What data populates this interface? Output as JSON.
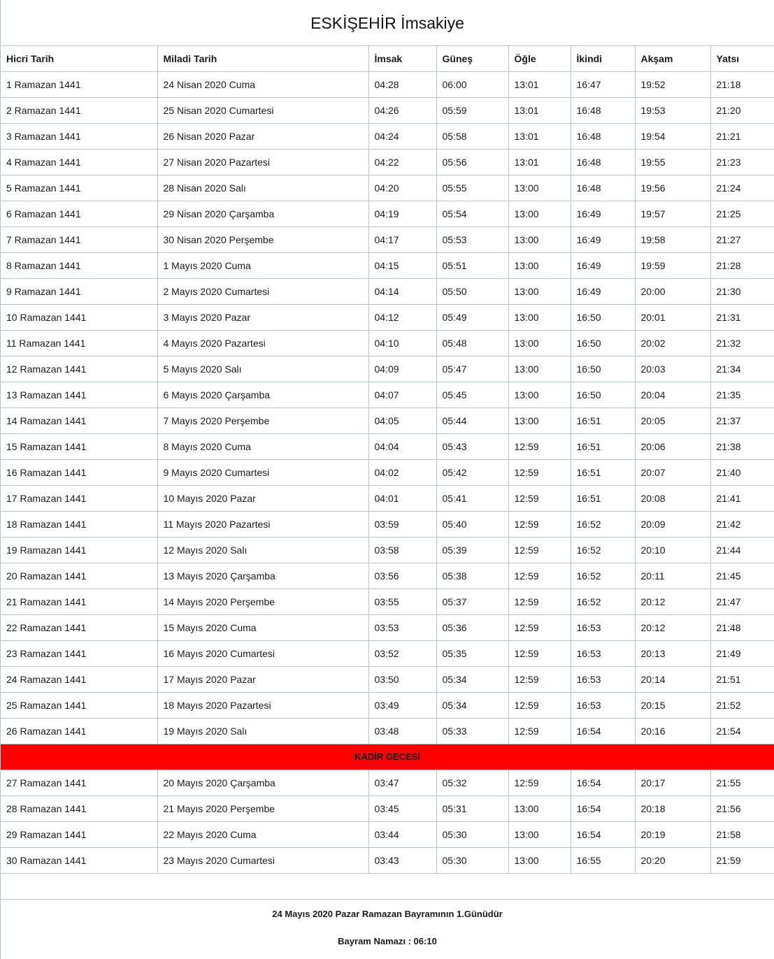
{
  "title": "ESKİŞEHİR İmsakiye",
  "headers": [
    "Hicri Tarih",
    "Miladi Tarih",
    "İmsak",
    "Güneş",
    "Öğle",
    "İkindi",
    "Akşam",
    "Yatsı"
  ],
  "rows_a": [
    [
      "1 Ramazan 1441",
      "24 Nisan 2020 Cuma",
      "04:28",
      "06:00",
      "13:01",
      "16:47",
      "19:52",
      "21:18"
    ],
    [
      "2 Ramazan 1441",
      "25 Nisan 2020 Cumartesi",
      "04:26",
      "05:59",
      "13:01",
      "16:48",
      "19:53",
      "21:20"
    ],
    [
      "3 Ramazan 1441",
      "26 Nisan 2020 Pazar",
      "04:24",
      "05:58",
      "13:01",
      "16:48",
      "19:54",
      "21:21"
    ],
    [
      "4 Ramazan 1441",
      "27 Nisan 2020 Pazartesi",
      "04:22",
      "05:56",
      "13:01",
      "16:48",
      "19:55",
      "21:23"
    ],
    [
      "5 Ramazan 1441",
      "28 Nisan 2020 Salı",
      "04:20",
      "05:55",
      "13:00",
      "16:48",
      "19:56",
      "21:24"
    ],
    [
      "6 Ramazan 1441",
      "29 Nisan 2020 Çarşamba",
      "04:19",
      "05:54",
      "13:00",
      "16:49",
      "19:57",
      "21:25"
    ],
    [
      "7 Ramazan 1441",
      "30 Nisan 2020 Perşembe",
      "04:17",
      "05:53",
      "13:00",
      "16:49",
      "19:58",
      "21:27"
    ],
    [
      "8 Ramazan 1441",
      "1 Mayıs 2020 Cuma",
      "04:15",
      "05:51",
      "13:00",
      "16:49",
      "19:59",
      "21:28"
    ],
    [
      "9 Ramazan 1441",
      "2 Mayıs 2020 Cumartesi",
      "04:14",
      "05:50",
      "13:00",
      "16:49",
      "20:00",
      "21:30"
    ],
    [
      "10 Ramazan 1441",
      "3 Mayıs 2020 Pazar",
      "04:12",
      "05:49",
      "13:00",
      "16:50",
      "20:01",
      "21:31"
    ],
    [
      "11 Ramazan 1441",
      "4 Mayıs 2020 Pazartesi",
      "04:10",
      "05:48",
      "13:00",
      "16:50",
      "20:02",
      "21:32"
    ],
    [
      "12 Ramazan 1441",
      "5 Mayıs 2020 Salı",
      "04:09",
      "05:47",
      "13:00",
      "16:50",
      "20:03",
      "21:34"
    ],
    [
      "13 Ramazan 1441",
      "6 Mayıs 2020 Çarşamba",
      "04:07",
      "05:45",
      "13:00",
      "16:50",
      "20:04",
      "21:35"
    ],
    [
      "14 Ramazan 1441",
      "7 Mayıs 2020 Perşembe",
      "04:05",
      "05:44",
      "13:00",
      "16:51",
      "20:05",
      "21:37"
    ],
    [
      "15 Ramazan 1441",
      "8 Mayıs 2020 Cuma",
      "04:04",
      "05:43",
      "12:59",
      "16:51",
      "20:06",
      "21:38"
    ],
    [
      "16 Ramazan 1441",
      "9 Mayıs 2020 Cumartesi",
      "04:02",
      "05:42",
      "12:59",
      "16:51",
      "20:07",
      "21:40"
    ],
    [
      "17 Ramazan 1441",
      "10 Mayıs 2020 Pazar",
      "04:01",
      "05:41",
      "12:59",
      "16:51",
      "20:08",
      "21:41"
    ],
    [
      "18 Ramazan 1441",
      "11 Mayıs 2020 Pazartesi",
      "03:59",
      "05:40",
      "12:59",
      "16:52",
      "20:09",
      "21:42"
    ],
    [
      "19 Ramazan 1441",
      "12 Mayıs 2020 Salı",
      "03:58",
      "05:39",
      "12:59",
      "16:52",
      "20:10",
      "21:44"
    ],
    [
      "20 Ramazan 1441",
      "13 Mayıs 2020 Çarşamba",
      "03:56",
      "05:38",
      "12:59",
      "16:52",
      "20:11",
      "21:45"
    ],
    [
      "21 Ramazan 1441",
      "14 Mayıs 2020 Perşembe",
      "03:55",
      "05:37",
      "12:59",
      "16:52",
      "20:12",
      "21:47"
    ],
    [
      "22 Ramazan 1441",
      "15 Mayıs 2020 Cuma",
      "03:53",
      "05:36",
      "12:59",
      "16:53",
      "20:12",
      "21:48"
    ],
    [
      "23 Ramazan 1441",
      "16 Mayıs 2020 Cumartesi",
      "03:52",
      "05:35",
      "12:59",
      "16:53",
      "20:13",
      "21:49"
    ],
    [
      "24 Ramazan 1441",
      "17 Mayıs 2020 Pazar",
      "03:50",
      "05:34",
      "12:59",
      "16:53",
      "20:14",
      "21:51"
    ],
    [
      "25 Ramazan 1441",
      "18 Mayıs 2020 Pazartesi",
      "03:49",
      "05:34",
      "12:59",
      "16:53",
      "20:15",
      "21:52"
    ],
    [
      "26 Ramazan 1441",
      "19 Mayıs 2020 Salı",
      "03:48",
      "05:33",
      "12:59",
      "16:54",
      "20:16",
      "21:54"
    ]
  ],
  "kadir_label": "KADİR GECESİ",
  "kadir_color": "#ff0000",
  "rows_b": [
    [
      "27 Ramazan 1441",
      "20 Mayıs 2020 Çarşamba",
      "03:47",
      "05:32",
      "12:59",
      "16:54",
      "20:17",
      "21:55"
    ],
    [
      "28 Ramazan 1441",
      "21 Mayıs 2020 Perşembe",
      "03:45",
      "05:31",
      "13:00",
      "16:54",
      "20:18",
      "21:56"
    ],
    [
      "29 Ramazan 1441",
      "22 Mayıs 2020 Cuma",
      "03:44",
      "05:30",
      "13:00",
      "16:54",
      "20:19",
      "21:58"
    ],
    [
      "30 Ramazan 1441",
      "23 Mayıs 2020 Cumartesi",
      "03:43",
      "05:30",
      "13:00",
      "16:55",
      "20:20",
      "21:59"
    ]
  ],
  "footer": {
    "bayram_day": "24 Mayıs 2020 Pazar Ramazan Bayramının 1.Günüdür",
    "bayram_namazi": "Bayram Namazı : 06:10"
  }
}
